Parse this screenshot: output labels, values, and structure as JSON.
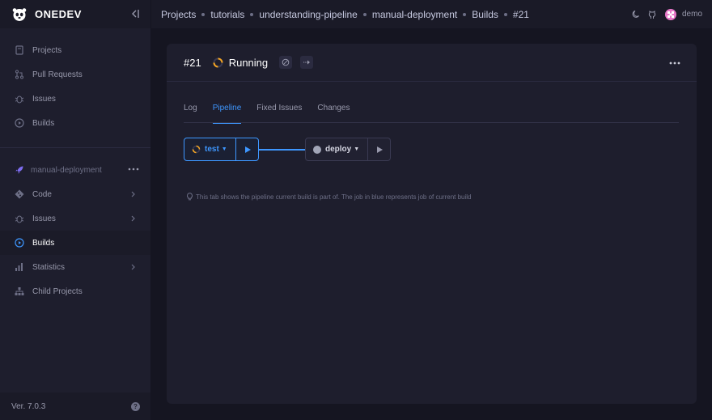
{
  "brand": {
    "name": "ONEDEV"
  },
  "sidebar": {
    "global_items": [
      {
        "label": "Projects",
        "icon": "projects-icon"
      },
      {
        "label": "Pull Requests",
        "icon": "pull-request-icon"
      },
      {
        "label": "Issues",
        "icon": "bug-icon"
      },
      {
        "label": "Builds",
        "icon": "play-circle-icon"
      }
    ],
    "project": {
      "name": "manual-deployment"
    },
    "project_items": [
      {
        "label": "Code",
        "icon": "code-icon",
        "has_children": true
      },
      {
        "label": "Issues",
        "icon": "bug-icon",
        "has_children": true
      },
      {
        "label": "Builds",
        "icon": "play-circle-icon",
        "active": true
      },
      {
        "label": "Statistics",
        "icon": "bar-chart-icon",
        "has_children": true
      },
      {
        "label": "Child Projects",
        "icon": "tree-icon"
      }
    ],
    "version": "Ver. 7.0.3"
  },
  "breadcrumb": [
    "Projects",
    "tutorials",
    "understanding-pipeline",
    "manual-deployment",
    "Builds",
    "#21"
  ],
  "user": {
    "name": "demo"
  },
  "build": {
    "number": "#21",
    "status": "Running"
  },
  "tabs": [
    {
      "label": "Log"
    },
    {
      "label": "Pipeline",
      "active": true
    },
    {
      "label": "Fixed Issues"
    },
    {
      "label": "Changes"
    }
  ],
  "pipeline": {
    "jobs": [
      {
        "name": "test",
        "state": "running"
      },
      {
        "name": "deploy",
        "state": "waiting"
      }
    ]
  },
  "hint": "This tab shows the pipeline current build is part of. The job in blue represents job of current build",
  "colors": {
    "accent": "#3e97ff",
    "running": "#f6a623",
    "sidebar_bg": "#1e1e2d",
    "page_bg": "#151521"
  }
}
